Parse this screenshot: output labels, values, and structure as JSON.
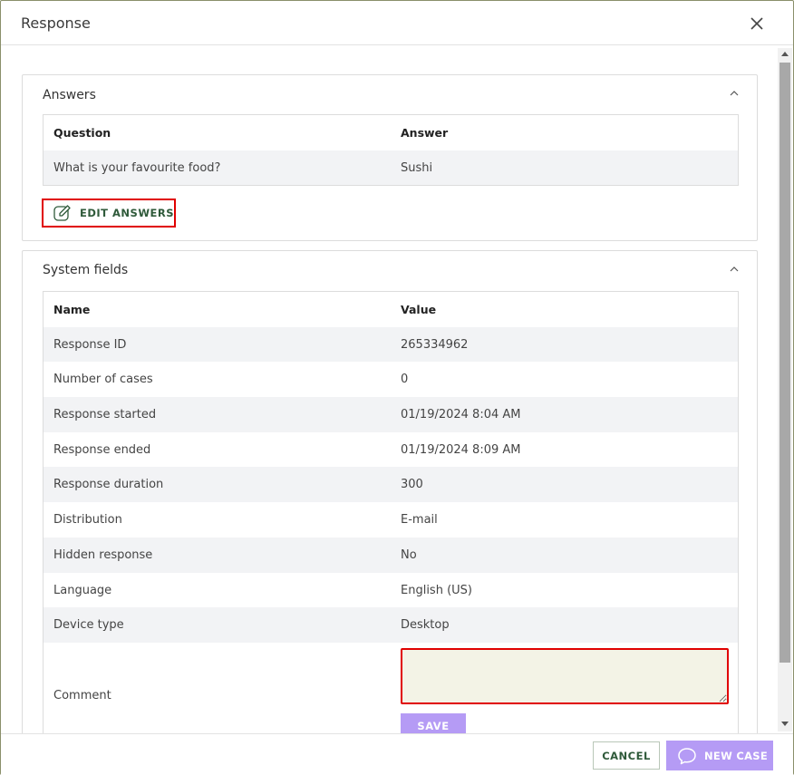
{
  "dialog": {
    "title": "Response"
  },
  "answers": {
    "title": "Answers",
    "columns": [
      "Question",
      "Answer"
    ],
    "rows": [
      [
        "What is your favourite food?",
        "Sushi"
      ]
    ],
    "edit_label": "EDIT ANSWERS"
  },
  "system_fields": {
    "title": "System fields",
    "columns": [
      "Name",
      "Value"
    ],
    "rows": [
      [
        "Response ID",
        "265334962"
      ],
      [
        "Number of cases",
        "0"
      ],
      [
        "Response started",
        "01/19/2024 8:04 AM"
      ],
      [
        "Response ended",
        "01/19/2024 8:09 AM"
      ],
      [
        "Response duration",
        "300"
      ],
      [
        "Distribution",
        "E-mail"
      ],
      [
        "Hidden response",
        "No"
      ],
      [
        "Language",
        "English (US)"
      ],
      [
        "Device type",
        "Desktop"
      ]
    ],
    "comment_label": "Comment",
    "comment_value": "",
    "save_label": "SAVE"
  },
  "footer": {
    "cancel_label": "CANCEL",
    "new_case_label": "NEW CASE"
  },
  "colors": {
    "accent_purple": "#b59bf5",
    "highlight_red": "#e00000",
    "green_text": "#2f5a3a"
  }
}
